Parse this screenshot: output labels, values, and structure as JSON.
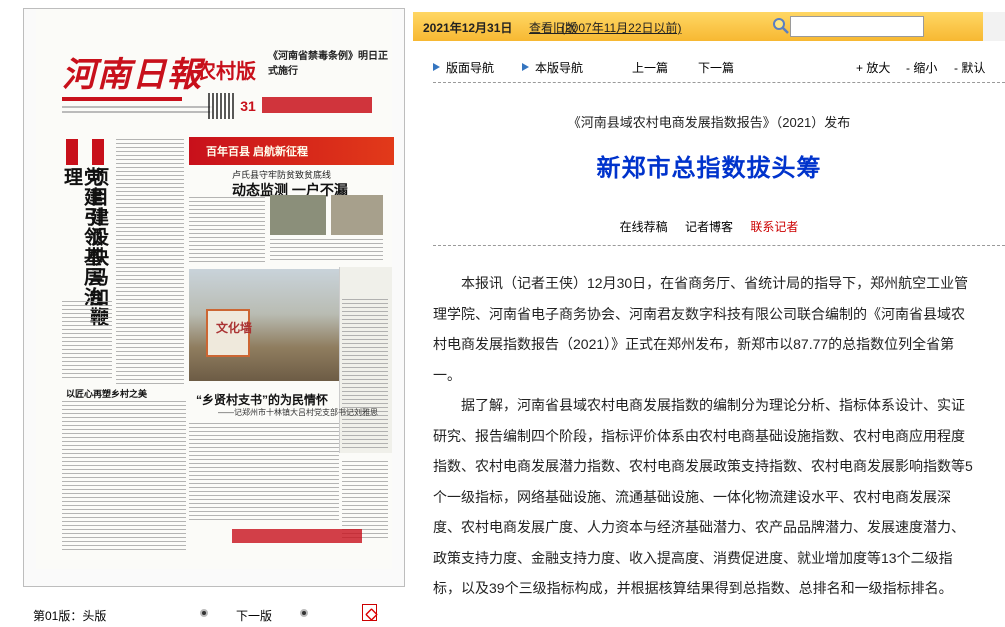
{
  "paper": {
    "masthead_title": "河南日報",
    "masthead_sub": "农村版",
    "masthead_headline": "《河南省禁毒条例》明日正式施行",
    "date_number": "31",
    "left_vertical_headline_1": "党建引领基层治理",
    "left_vertical_headline_2": "项目建设快马加鞭",
    "feature_banner": "百年百县 启航新征程",
    "feature_subhead": "卢氏县守牢防贫致贫底线",
    "feature_headline": "动态监测  一户不漏",
    "photo_label": "文化墙",
    "lower_headline": "“乡贤村支书”的为民情怀",
    "lower_subhead": "——记郑州市十林镇大吕村党支部书记刘雅思",
    "left_lower_headline": "以匠心再塑乡村之美"
  },
  "paper_footer": {
    "edition": "第01版：头版",
    "next_page": "下一版"
  },
  "topbar": {
    "date": "2021年12月31日",
    "old_edition_link": "查看旧版",
    "old_edition_range": "(2007年11月22日以前)",
    "search_value": ""
  },
  "toolbar": {
    "page_nav": "版面导航",
    "article_nav": "本版导航",
    "prev_article": "上一篇",
    "next_article": "下一篇",
    "zoom_in": "放大",
    "zoom_out": "缩小",
    "default": "默认"
  },
  "article": {
    "subtitle": "《河南县域农村电商发展指数报告》（2021）发布",
    "title": "新郑市总指数拔头筹",
    "link_recommend": "在线荐稿",
    "link_blog": "记者博客",
    "link_contact": "联系记者",
    "paragraphs": [
      "本报讯（记者王侠）12月30日，在省商务厅、省统计局的指导下，郑州航空工业管理学院、河南省电子商务协会、河南君友数字科技有限公司联合编制的《河南省县域农村电商发展指数报告（2021）》正式在郑州发布，新郑市以87.77的总指数位列全省第一。",
      "据了解，河南省县域农村电商发展指数的编制分为理论分析、指标体系设计、实证研究、报告编制四个阶段，指标评价体系由农村电商基础设施指数、农村电商应用程度指数、农村电商发展潜力指数、农村电商发展政策支持指数、农村电商发展影响指数等5个一级指标，网络基础设施、流通基础设施、一体化物流建设水平、农村电商发展深度、农村电商发展广度、人力资本与经济基础潜力、农产品品牌潜力、发展速度潜力、政策支持力度、金融支持力度、收入提高度、消费促进度、就业增加度等13个二级指标，以及39个三级指标构成，并根据核算结果得到总指数、总排名和一级指标排名。"
    ]
  },
  "colors": {
    "topbar": "#f7b832",
    "title_blue": "#0033cc",
    "accent_red": "#c8101b",
    "toolbar_arrow": "#3575c0"
  }
}
